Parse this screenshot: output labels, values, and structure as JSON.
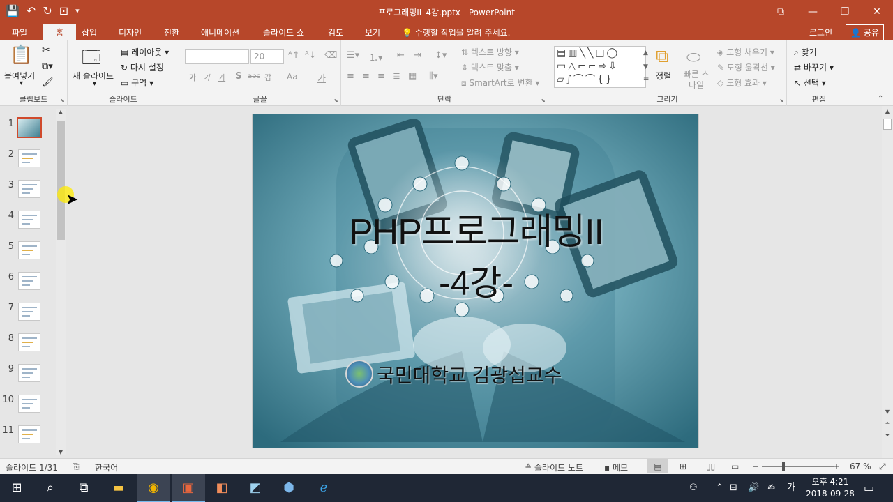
{
  "window": {
    "title": "프로그래밍II_4강.pptx - PowerPoint"
  },
  "qat": {
    "save": "💾",
    "undo": "↶",
    "redo": "↻",
    "present": "⊡",
    "more": "▾"
  },
  "window_controls": {
    "ribbon_opts": "⧉",
    "minimize": "—",
    "restore": "❐",
    "close": "✕"
  },
  "tabs": [
    "파일",
    "홈",
    "삽입",
    "디자인",
    "전환",
    "애니메이션",
    "슬라이드 쇼",
    "검토",
    "보기"
  ],
  "tell_me": "수행할 작업을 알려 주세요.",
  "signin": "로그인",
  "share": "공유",
  "ribbon": {
    "clipboard": {
      "label": "클립보드",
      "paste": "붙여넣기"
    },
    "slides": {
      "label": "슬라이드",
      "new_slide": "새 슬라이드",
      "layout": "레이아웃",
      "reset": "다시 설정",
      "section": "구역"
    },
    "font": {
      "label": "글꼴",
      "font_name": "",
      "font_size": "20",
      "bold": "가",
      "italic": "가",
      "underline": "가",
      "shadow": "S",
      "strike": "abc",
      "spacing": "갑",
      "case": "Aa",
      "color": "가"
    },
    "paragraph": {
      "label": "단락",
      "text_direction": "텍스트 방향",
      "align_text": "텍스트 맞춤",
      "smartart": "SmartArt로 변환"
    },
    "drawing": {
      "label": "그리기",
      "arrange": "정렬",
      "quick_styles": "빠른 스타일",
      "shape_fill": "도형 채우기",
      "shape_outline": "도형 윤곽선",
      "shape_effects": "도형 효과"
    },
    "editing": {
      "label": "편집",
      "find": "찾기",
      "replace": "바꾸기",
      "select": "선택"
    }
  },
  "slide_thumbnails": [
    "1",
    "2",
    "3",
    "4",
    "5",
    "6",
    "7",
    "8",
    "9",
    "10",
    "11"
  ],
  "slide": {
    "title": "PHP프로그래밍II",
    "subtitle": "-4강-",
    "author": "국민대학교 김광섭교수"
  },
  "status": {
    "slide_counter": "슬라이드 1/31",
    "language": "한국어",
    "notes": "슬라이드 노트",
    "comments": "메모",
    "zoom": "67 %"
  },
  "taskbar": {
    "clock_time": "오후 4:21",
    "clock_date": "2018-09-28",
    "ime": "가"
  },
  "colors": {
    "accent": "#b7472a",
    "selected_thumb_border": "#d04a2c",
    "taskbar": "#1f2735"
  }
}
